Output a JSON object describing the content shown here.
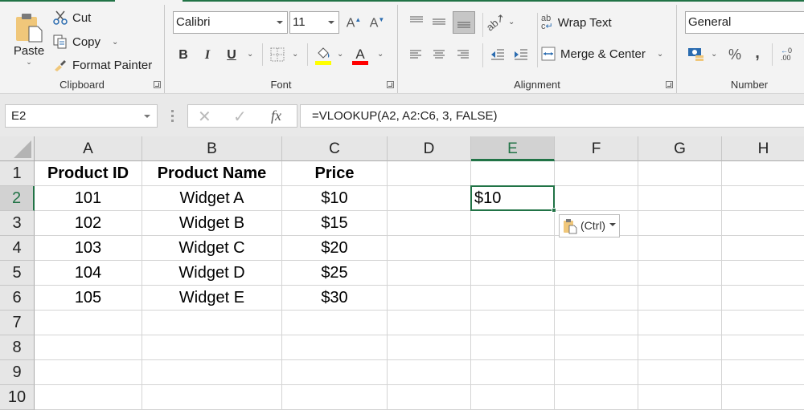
{
  "ribbon": {
    "clipboard": {
      "label": "Clipboard",
      "paste": "Paste",
      "cut": "Cut",
      "copy": "Copy",
      "format_painter": "Format Painter"
    },
    "font": {
      "label": "Font",
      "font_name": "Calibri",
      "font_size": "11",
      "bold": "B",
      "italic": "I",
      "underline": "U",
      "highlight_color": "#ffff00",
      "font_color": "#ff0000"
    },
    "alignment": {
      "label": "Alignment",
      "wrap_text": "Wrap Text",
      "merge_center": "Merge & Center"
    },
    "number": {
      "label": "Number",
      "format": "General",
      "percent": "%",
      "comma": ","
    }
  },
  "formula_bar": {
    "name_box": "E2",
    "fx": "fx",
    "formula": "=VLOOKUP(A2, A2:C6, 3, FALSE)"
  },
  "sheet": {
    "columns": [
      "A",
      "B",
      "C",
      "D",
      "E",
      "F",
      "G",
      "H"
    ],
    "selected_column": "E",
    "rows": [
      "1",
      "2",
      "3",
      "4",
      "5",
      "6",
      "7",
      "8",
      "9",
      "10"
    ],
    "selected_row": "2",
    "header": [
      "Product ID",
      "Product Name",
      "Price"
    ],
    "data": [
      [
        "101",
        "Widget A",
        "$10"
      ],
      [
        "102",
        "Widget B",
        "$15"
      ],
      [
        "103",
        "Widget C",
        "$20"
      ],
      [
        "104",
        "Widget D",
        "$25"
      ],
      [
        "105",
        "Widget E",
        "$30"
      ]
    ],
    "active_cell": {
      "ref": "E2",
      "value": "$10"
    },
    "paste_options": "(Ctrl)"
  },
  "colors": {
    "accent": "#217346"
  }
}
